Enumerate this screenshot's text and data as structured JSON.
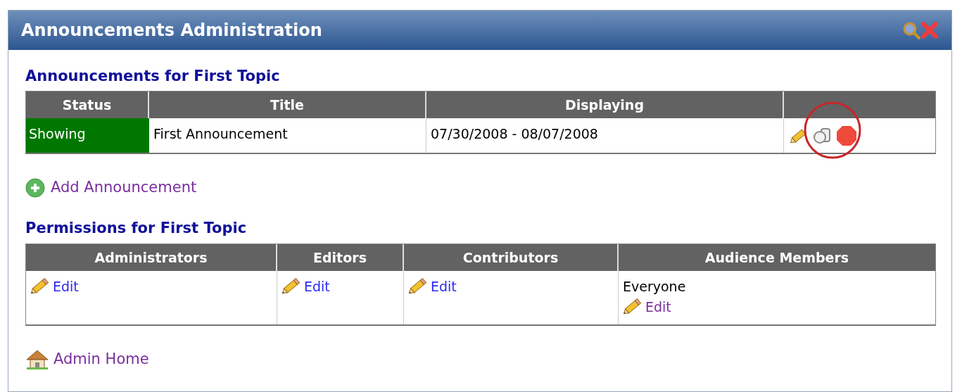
{
  "window": {
    "title": "Announcements Administration"
  },
  "announcements": {
    "heading": "Announcements for First Topic",
    "columns": [
      "Status",
      "Title",
      "Displaying"
    ],
    "rows": [
      {
        "status": "Showing",
        "color": "#007700",
        "title": "First Announcement",
        "displaying": "07/30/2008 - 08/07/2008"
      }
    ]
  },
  "add_link": {
    "label": "Add Announcement",
    "visited": true
  },
  "permissions": {
    "heading": "Permissions for First Topic",
    "columns": [
      "Administrators",
      "Editors",
      "Contributors",
      "Audience Members"
    ],
    "cells": [
      {
        "link": {
          "label": "Edit",
          "visited": false
        }
      },
      {
        "link": {
          "label": "Edit",
          "visited": false
        }
      },
      {
        "link": {
          "label": "Edit",
          "visited": false
        }
      },
      {
        "note": "Everyone",
        "link": {
          "label": "Edit",
          "visited": true
        }
      }
    ]
  },
  "home_link": {
    "label": "Admin Home",
    "visited": true
  }
}
